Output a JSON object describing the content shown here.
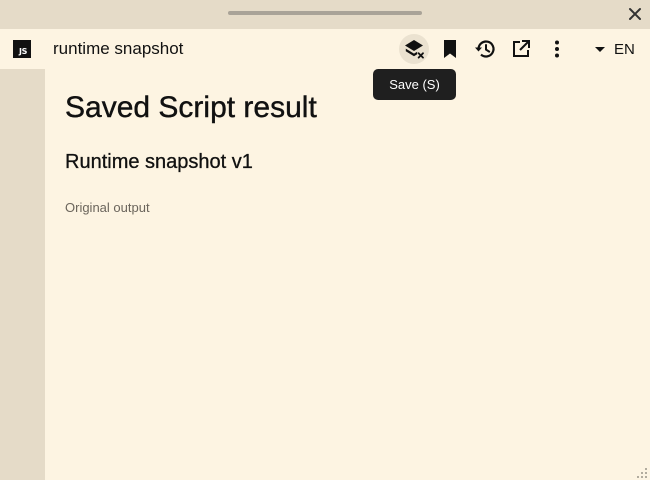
{
  "window": {
    "background": "#fdf4e2",
    "chrome_color": "#e5dbc8"
  },
  "toolbar": {
    "logo_text": "JS",
    "page_name": "runtime snapshot",
    "icons": [
      "save-layers-icon",
      "bookmark-icon",
      "history-icon",
      "open-external-icon",
      "more-vert-icon"
    ],
    "language": "EN"
  },
  "tooltip": {
    "text": "Save (S)"
  },
  "content": {
    "title": "Saved Script result",
    "subtitle": "Runtime snapshot v1",
    "caption": "Original output"
  }
}
